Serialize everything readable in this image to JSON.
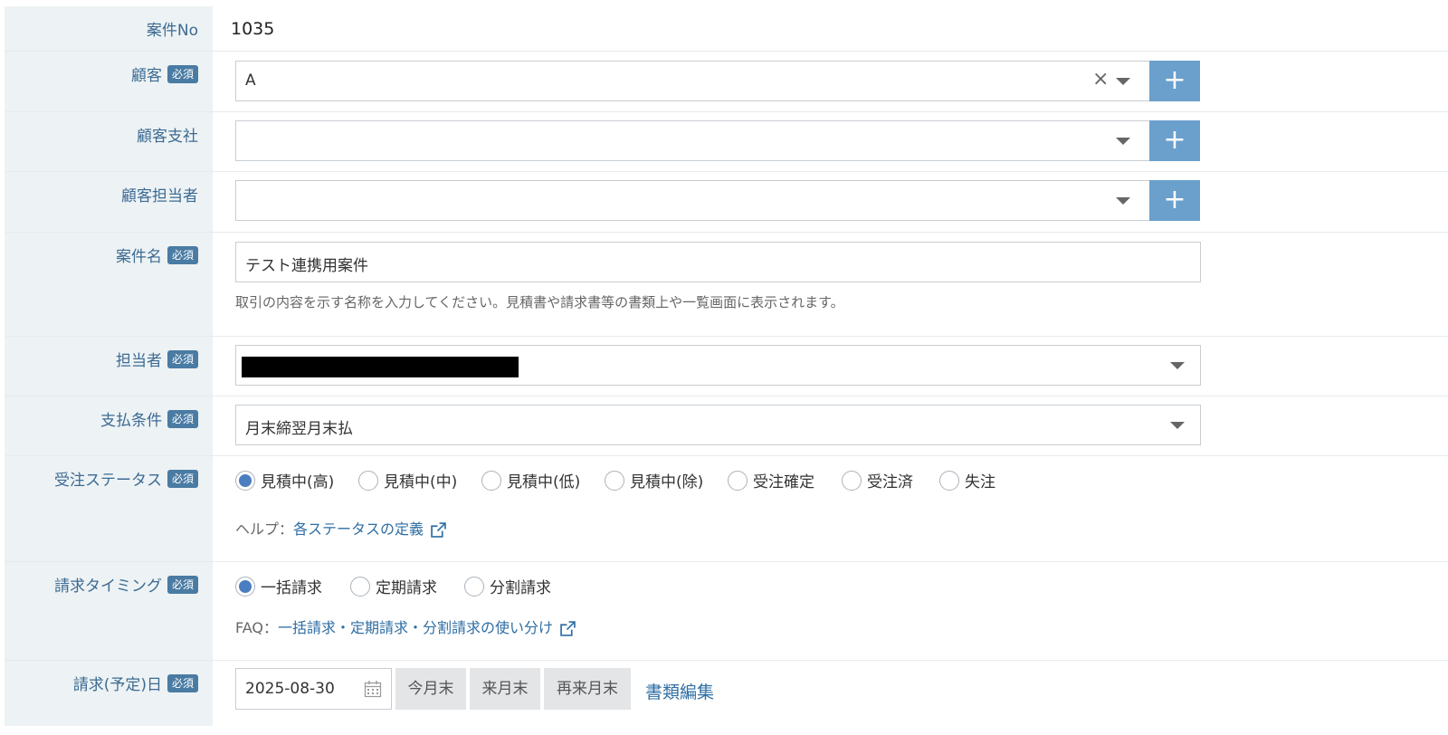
{
  "form": {
    "case_no": {
      "label": "案件No",
      "value": "1035"
    },
    "customer": {
      "label": "顧客",
      "required": "必須",
      "value": "A",
      "clear": "×",
      "add": "+"
    },
    "customer_branch": {
      "label": "顧客支社",
      "value": "",
      "add": "+"
    },
    "customer_contact": {
      "label": "顧客担当者",
      "value": "",
      "add": "+"
    },
    "case_name": {
      "label": "案件名",
      "required": "必須",
      "value": "テスト連携用案件",
      "hint": "取引の内容を示す名称を入力してください。見積書や請求書等の書類上や一覧画面に表示されます。"
    },
    "owner": {
      "label": "担当者",
      "required": "必須"
    },
    "payment_terms": {
      "label": "支払条件",
      "required": "必須",
      "value": "月末締翌月末払"
    },
    "order_status": {
      "label": "受注ステータス",
      "required": "必須",
      "options": [
        "見積中(高)",
        "見積中(中)",
        "見積中(低)",
        "見積中(除)",
        "受注確定",
        "受注済",
        "失注"
      ],
      "selected": "見積中(高)",
      "help_prefix": "ヘルプ：",
      "help_link": "各ステータスの定義"
    },
    "billing_timing": {
      "label": "請求タイミング",
      "required": "必須",
      "options": [
        "一括請求",
        "定期請求",
        "分割請求"
      ],
      "selected": "一括請求",
      "faq_prefix": "FAQ：",
      "faq_link": "一括請求・定期請求・分割請求の使い分け"
    },
    "billing_date": {
      "label": "請求(予定)日",
      "required": "必須",
      "value": "2025-08-30",
      "buttons": [
        "今月末",
        "来月末",
        "再来月末"
      ],
      "edit_link": "書類編集"
    }
  },
  "colors": {
    "label_bg": "#edf2f4",
    "label_text": "#3d6b93",
    "badge": "#4a7ba3",
    "plus_button": "#6ba0cc",
    "link": "#2f6ea3"
  }
}
